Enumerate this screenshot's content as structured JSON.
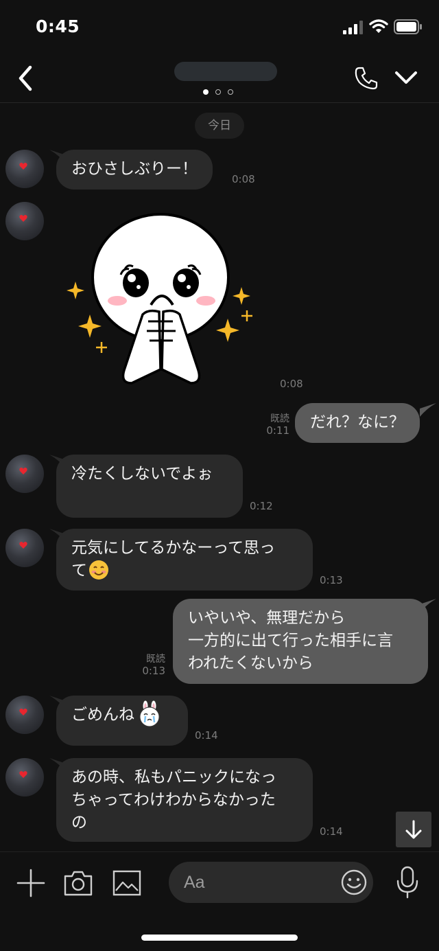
{
  "status_bar": {
    "time": "0:45"
  },
  "header": {
    "page_indicator": {
      "count": 3,
      "active": 1
    }
  },
  "date_chip": "今日",
  "messages": [
    {
      "side": "in",
      "text": "おひさしぶりー！",
      "time": "0:08"
    },
    {
      "side": "in",
      "type": "sticker",
      "sticker": "moon-face-sticker",
      "time": "0:08"
    },
    {
      "side": "out",
      "text": "だれ？なに？",
      "read": "既読",
      "time": "0:11"
    },
    {
      "side": "in",
      "text": "冷たくしないでよぉ",
      "time": "0:12"
    },
    {
      "side": "in",
      "text": "元気にしてるかなーって思っ\nて",
      "emoji": "smiling-face-emoji",
      "time": "0:13"
    },
    {
      "side": "out",
      "text": "いやいや、無理だから\n一方的に出て行った相手に言\nわれたくないから",
      "read": "既読",
      "time": "0:13"
    },
    {
      "side": "in",
      "text": "ごめんね",
      "emoji": "crying-bunny-emoji",
      "time": "0:14"
    },
    {
      "side": "in",
      "text": "あの時、私もパニックになっ\nちゃってわけわからなかった\nの",
      "time": "0:14"
    }
  ],
  "input": {
    "placeholder": "Aa"
  },
  "colors": {
    "background": "#111111",
    "incoming_bubble": "#2a2a2a",
    "outgoing_bubble": "#5b5b5b",
    "timestamp": "#7c7c7c",
    "sparkle": "#f5b829"
  }
}
